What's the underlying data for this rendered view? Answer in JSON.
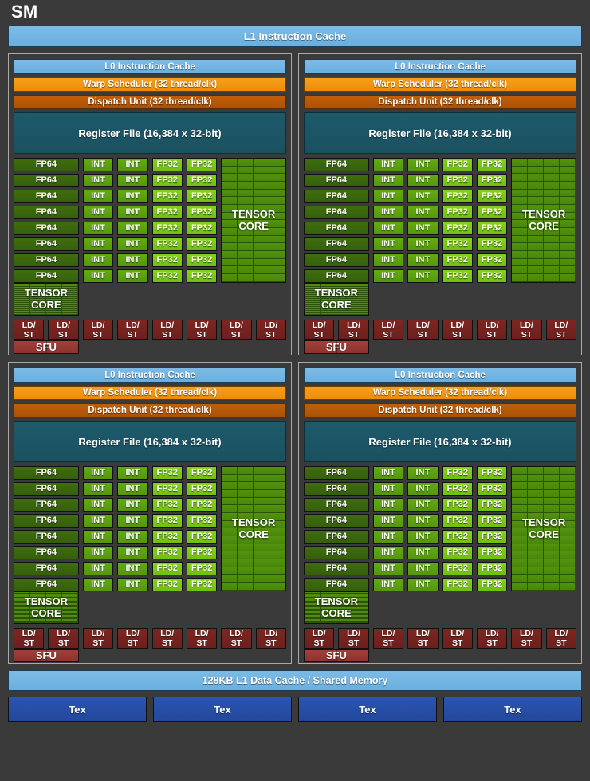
{
  "diagram": {
    "title": "SM",
    "l1_instruction_cache": "L1 Instruction Cache",
    "l1_data_cache": "128KB L1 Data Cache / Shared Memory"
  },
  "labels": {
    "l0_instruction_cache": "L0 Instruction Cache",
    "warp_scheduler": "Warp Scheduler (32 thread/clk)",
    "dispatch_unit": "Dispatch Unit (32 thread/clk)",
    "register_file": "Register File (16,384 x 32-bit)",
    "fp64": "FP64",
    "int": "INT",
    "fp32": "FP32",
    "tensor_core_line1": "TENSOR",
    "tensor_core_line2": "CORE",
    "ldst_line1": "LD/",
    "ldst_line2": "ST",
    "sfu": "SFU",
    "tex": "Tex"
  },
  "counts": {
    "processing_blocks": 4,
    "fp64_per_block": 8,
    "int_columns_per_block": 2,
    "int_rows_per_block": 8,
    "fp32_columns_per_block": 2,
    "fp32_rows_per_block": 8,
    "tensor_cores_per_block": 2,
    "tensor_grid_columns": 4,
    "tensor_grid_rows": 16,
    "ldst_per_block": 8,
    "sfu_per_block": 1,
    "tex_units": 4
  },
  "colors": {
    "background": "#3a3a3a",
    "frame_border": "#a9a9a9",
    "cache_blue": "#7dbbe6",
    "warp_orange": "#f6a01e",
    "dispatch_orange": "#c05f08",
    "register_teal": "#1e5a6b",
    "fp64_green": "#3f6d0e",
    "int_green": "#64ab11",
    "fp32_green": "#83d318",
    "tensor_green": "#52930f",
    "ldst_red": "#7d2622",
    "sfu_red": "#a2403a",
    "tex_blue": "#2a55b0",
    "text": "#ffffff"
  }
}
